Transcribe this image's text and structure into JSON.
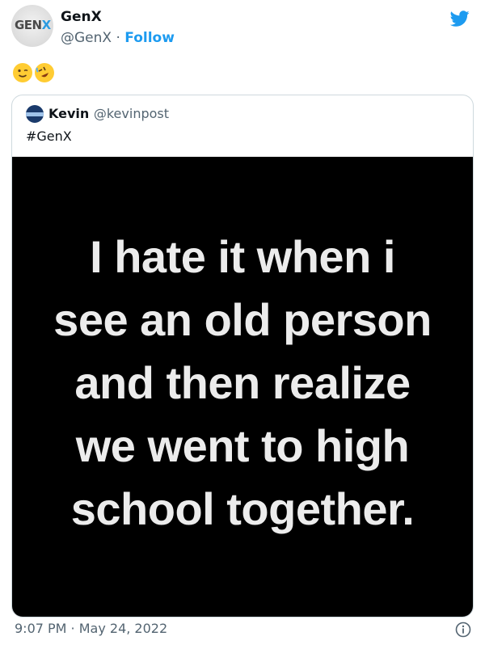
{
  "author": {
    "avatar_text_main": "GEN",
    "avatar_text_accent": "X",
    "display_name": "GenX",
    "handle": "@GenX",
    "separator": " · ",
    "follow_label": "Follow"
  },
  "tweet": {
    "emojis": [
      "winking-face",
      "rolling-on-the-floor-laughing"
    ],
    "timestamp": "9:07 PM · May 24, 2022"
  },
  "quoted_tweet": {
    "display_name": "Kevin",
    "handle": "@kevinpost",
    "text": "#GenX",
    "image_text_lines": [
      "I hate it when i",
      "see an old person",
      "and then realize",
      "we went to high",
      "school together."
    ]
  },
  "icons": {
    "brand": "twitter-bird-icon",
    "info": "info-icon"
  },
  "colors": {
    "accent": "#1d9bf0",
    "muted_text": "#536471",
    "card_border": "#cfd9de",
    "image_background": "#000000"
  }
}
